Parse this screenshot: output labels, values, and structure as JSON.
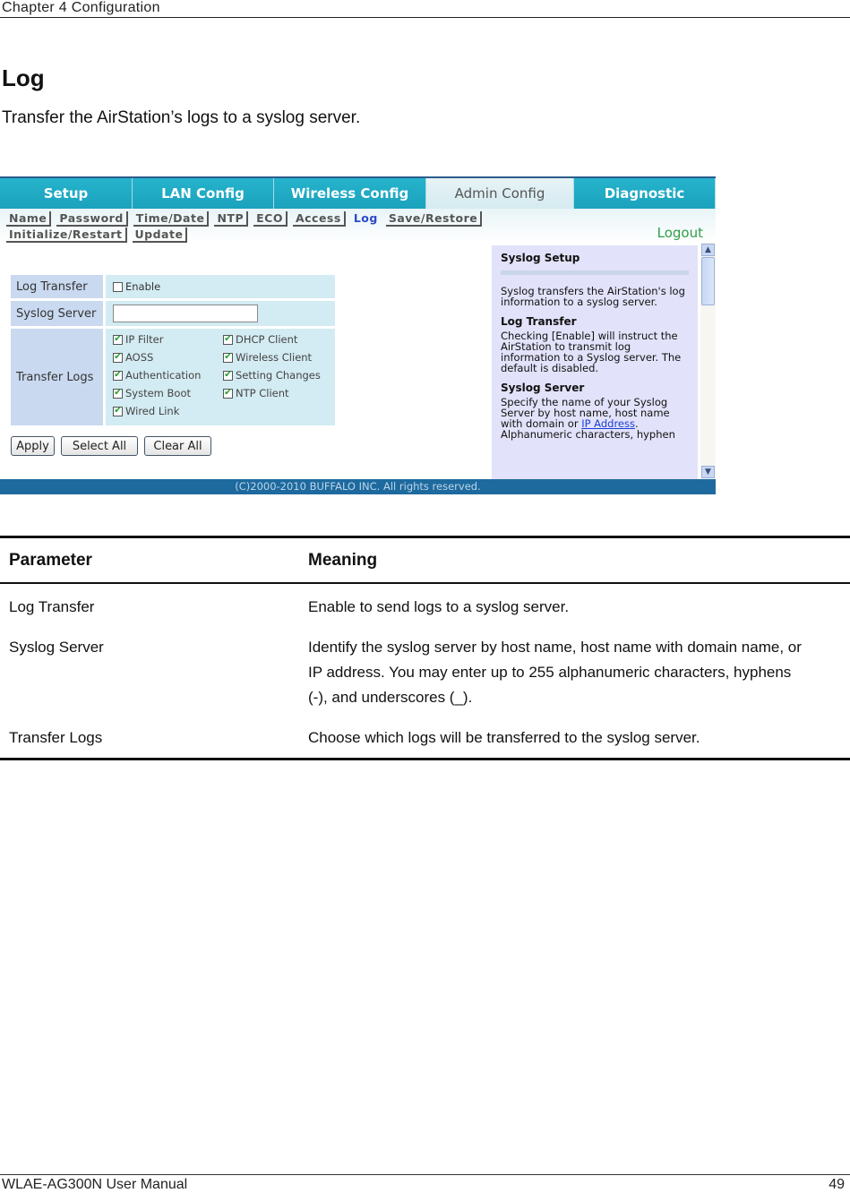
{
  "header": {
    "chapter": "Chapter 4  Configuration"
  },
  "section": {
    "title": "Log",
    "subtitle": "Transfer the AirStation’s logs to a syslog server."
  },
  "screenshot": {
    "top_tabs": [
      {
        "label": "Setup",
        "active": false
      },
      {
        "label": "LAN Config",
        "active": false
      },
      {
        "label": "Wireless Config",
        "active": false
      },
      {
        "label": "Admin Config",
        "active": true
      },
      {
        "label": "Diagnostic",
        "active": false
      }
    ],
    "sub_tabs_row1": [
      "Name",
      "Password",
      "Time/Date",
      "NTP",
      "ECO",
      "Access",
      "Log",
      "Save/Restore"
    ],
    "sub_tabs_row2": [
      "Initialize/Restart",
      "Update"
    ],
    "active_sub_tab": "Log",
    "logout_label": "Logout",
    "form": {
      "log_transfer_label": "Log Transfer",
      "enable_label": "Enable",
      "enable_checked": false,
      "syslog_server_label": "Syslog Server",
      "syslog_server_value": "",
      "transfer_logs_label": "Transfer Logs",
      "log_types": [
        {
          "label": "IP Filter",
          "checked": true
        },
        {
          "label": "DHCP Client",
          "checked": true
        },
        {
          "label": "AOSS",
          "checked": true
        },
        {
          "label": "Wireless Client",
          "checked": true
        },
        {
          "label": "Authentication",
          "checked": true
        },
        {
          "label": "Setting Changes",
          "checked": true
        },
        {
          "label": "System Boot",
          "checked": true
        },
        {
          "label": "NTP Client",
          "checked": true
        },
        {
          "label": "Wired Link",
          "checked": true
        }
      ],
      "buttons": {
        "apply": "Apply",
        "select_all": "Select All",
        "clear_all": "Clear All"
      }
    },
    "help": {
      "title": "Syslog Setup",
      "intro": "Syslog transfers the AirStation's log information to a syslog server.",
      "log_transfer_heading": "Log Transfer",
      "log_transfer_text": "Checking [Enable] will instruct the AirStation to transmit log information to a Syslog server. The default is disabled.",
      "syslog_server_heading": "Syslog Server",
      "syslog_server_text_before": "Specify the name of your Syslog Server by host name, host name with domain or ",
      "syslog_server_link": "IP Address",
      "syslog_server_text_after": ". Alphanumeric characters, hyphen"
    },
    "copyright": "(C)2000-2010 BUFFALO INC. All rights reserved."
  },
  "parameter_table": {
    "headers": {
      "parameter": "Parameter",
      "meaning": "Meaning"
    },
    "rows": [
      {
        "parameter": "Log Transfer",
        "meaning": "Enable to send logs to a syslog server."
      },
      {
        "parameter": "Syslog Server",
        "meaning": "Identify the syslog server by host name, host name with domain name, or IP address.  You may enter up to 255 alphanumeric characters, hyphens (-), and underscores (_)."
      },
      {
        "parameter": "Transfer Logs",
        "meaning": "Choose which logs will be transferred to the syslog server."
      }
    ]
  },
  "footer": {
    "manual": "WLAE-AG300N User Manual",
    "page": "49"
  }
}
